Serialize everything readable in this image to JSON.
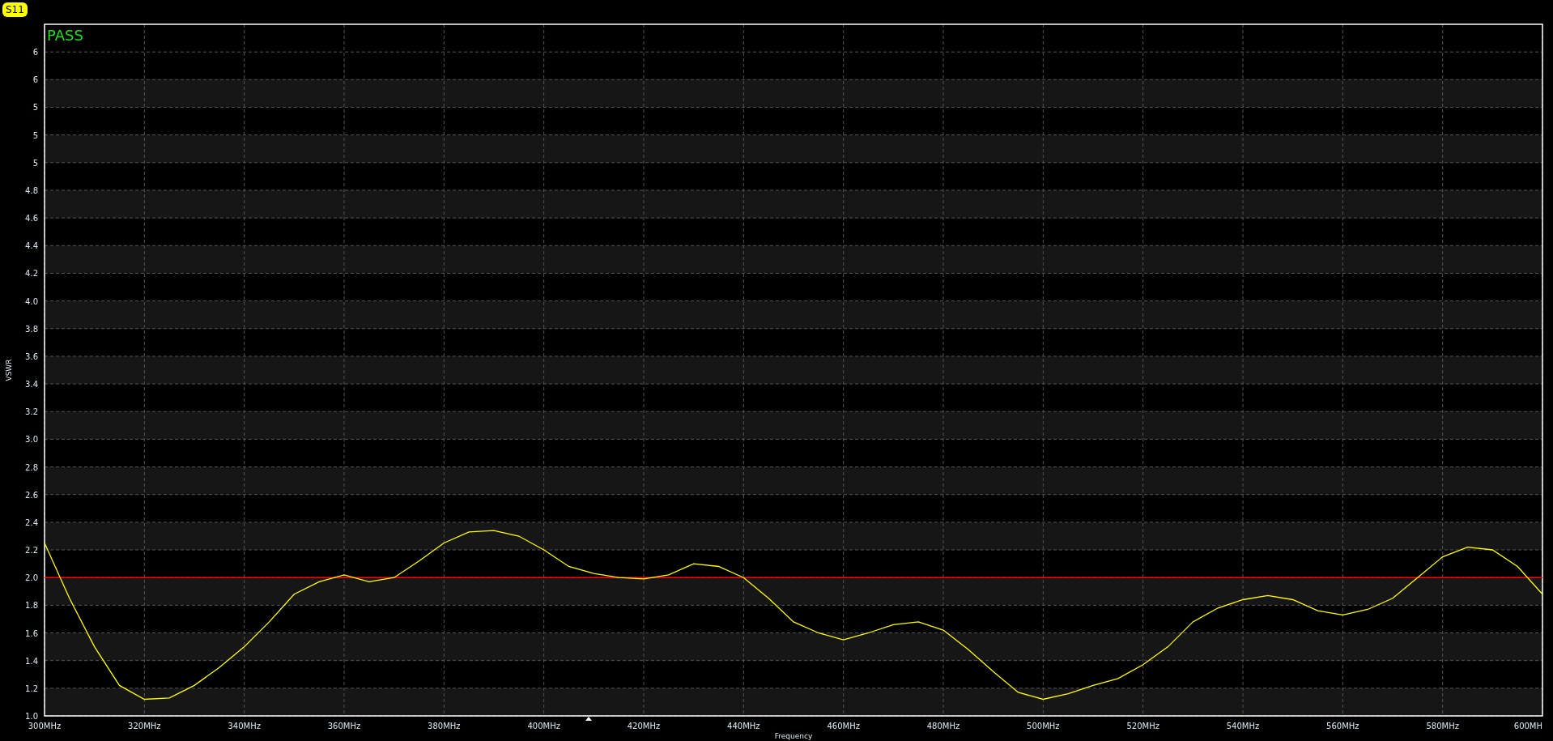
{
  "chart": {
    "status": "PASS",
    "chart_data": {
      "type": "line",
      "xlabel": "Frequency",
      "ylabel": "VSWR",
      "x": [
        300,
        305,
        310,
        315,
        320,
        325,
        330,
        335,
        340,
        345,
        350,
        355,
        360,
        365,
        370,
        375,
        380,
        385,
        390,
        395,
        400,
        405,
        410,
        415,
        420,
        425,
        430,
        435,
        440,
        445,
        450,
        455,
        460,
        465,
        470,
        475,
        480,
        485,
        490,
        495,
        500,
        505,
        510,
        515,
        520,
        525,
        530,
        535,
        540,
        545,
        550,
        555,
        560,
        565,
        570,
        575,
        580,
        585,
        590,
        595,
        600
      ],
      "series": [
        {
          "name": "S11",
          "color": "#ffff00",
          "values": [
            2.25,
            1.85,
            1.5,
            1.22,
            1.12,
            1.13,
            1.22,
            1.35,
            1.5,
            1.68,
            1.88,
            1.97,
            2.02,
            1.97,
            2.0,
            2.12,
            2.25,
            2.33,
            2.34,
            2.3,
            2.2,
            2.08,
            2.03,
            2.0,
            1.99,
            2.02,
            2.1,
            2.08,
            2.0,
            1.85,
            1.68,
            1.6,
            1.55,
            1.6,
            1.66,
            1.68,
            1.62,
            1.48,
            1.32,
            1.17,
            1.12,
            1.16,
            1.22,
            1.27,
            1.37,
            1.5,
            1.68,
            1.78,
            1.84,
            1.87,
            1.84,
            1.76,
            1.73,
            1.77,
            1.85,
            2.0,
            2.15,
            2.22,
            2.2,
            2.08,
            1.88
          ]
        }
      ],
      "xlim": [
        300,
        600
      ],
      "ylim": [
        1.0,
        6.0
      ],
      "xticks": [
        {
          "value": 300,
          "label": "300MHz"
        },
        {
          "value": 320,
          "label": "320MHz"
        },
        {
          "value": 340,
          "label": "340MHz"
        },
        {
          "value": 360,
          "label": "360MHz"
        },
        {
          "value": 380,
          "label": "380MHz"
        },
        {
          "value": 400,
          "label": "400MHz"
        },
        {
          "value": 420,
          "label": "420MHz"
        },
        {
          "value": 440,
          "label": "440MHz"
        },
        {
          "value": 460,
          "label": "460MHz"
        },
        {
          "value": 480,
          "label": "480MHz"
        },
        {
          "value": 500,
          "label": "500MHz"
        },
        {
          "value": 520,
          "label": "520MHz"
        },
        {
          "value": 540,
          "label": "540MHz"
        },
        {
          "value": 560,
          "label": "560MHz"
        },
        {
          "value": 580,
          "label": "580MHz"
        },
        {
          "value": 600,
          "label": "600MH"
        }
      ],
      "yticks": [
        {
          "value": 1.0,
          "label": "1.0"
        },
        {
          "value": 1.2,
          "label": "1.2"
        },
        {
          "value": 1.4,
          "label": "1.4"
        },
        {
          "value": 1.6,
          "label": "1.6"
        },
        {
          "value": 1.8,
          "label": "1.8"
        },
        {
          "value": 2.0,
          "label": "2.0"
        },
        {
          "value": 2.2,
          "label": "2.2"
        },
        {
          "value": 2.4,
          "label": "2.4"
        },
        {
          "value": 2.6,
          "label": "2.6"
        },
        {
          "value": 2.8,
          "label": "2.8"
        },
        {
          "value": 3.0,
          "label": "3.0"
        },
        {
          "value": 3.2,
          "label": "3.2"
        },
        {
          "value": 3.4,
          "label": "3.4"
        },
        {
          "value": 3.6,
          "label": "3.6"
        },
        {
          "value": 3.8,
          "label": "3.8"
        },
        {
          "value": 4.0,
          "label": "4.0"
        },
        {
          "value": 4.2,
          "label": "4.2"
        },
        {
          "value": 4.4,
          "label": "4.4"
        },
        {
          "value": 4.6,
          "label": "4.6"
        },
        {
          "value": 4.8,
          "label": "4.8"
        },
        {
          "value": 5.0,
          "label": "5"
        },
        {
          "value": 5.2,
          "label": "5"
        },
        {
          "value": 5.4,
          "label": "5"
        },
        {
          "value": 5.6,
          "label": "6"
        },
        {
          "value": 5.8,
          "label": "6"
        }
      ],
      "grid": true,
      "ref_lines": [
        {
          "axis": "y",
          "value": 2.0,
          "color": "#ff0000"
        }
      ]
    }
  }
}
